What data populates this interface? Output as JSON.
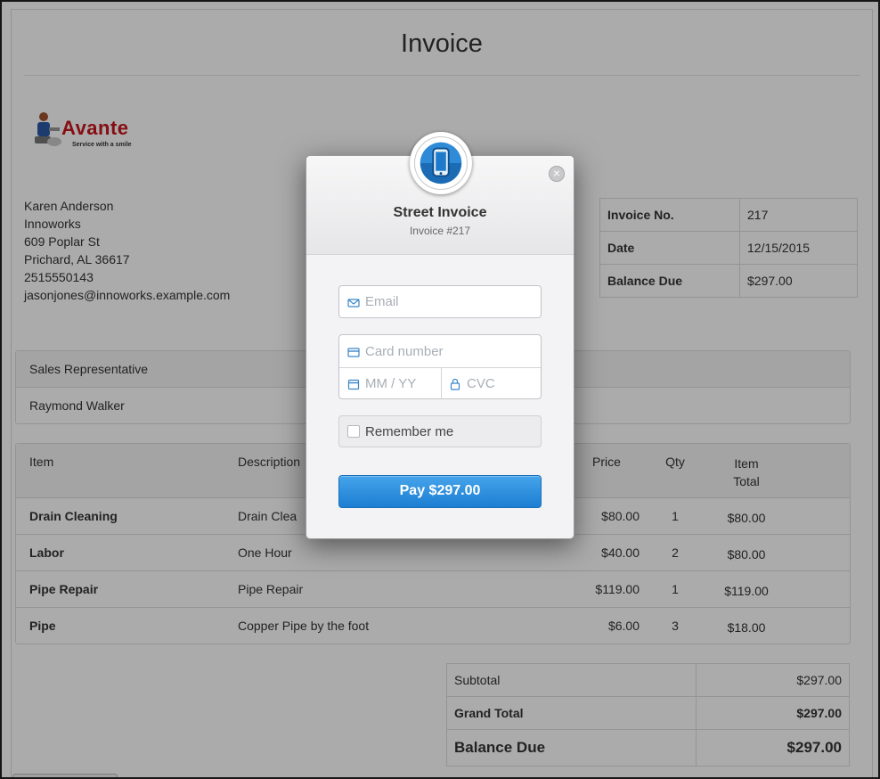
{
  "invoice": {
    "title": "Invoice",
    "logo": {
      "brand": "Avante",
      "tagline": "Service with a smile"
    },
    "customer": [
      "Karen Anderson",
      "Innoworks",
      "609 Poplar St",
      "Prichard, AL 36617",
      "2515550143",
      "jasonjones@innoworks.example.com"
    ],
    "meta": [
      {
        "label": "Invoice No.",
        "value": "217"
      },
      {
        "label": "Date",
        "value": "12/15/2015"
      },
      {
        "label": "Balance Due",
        "value": "$297.00"
      }
    ],
    "sales": {
      "header": "Sales Representative",
      "name": "Raymond Walker"
    },
    "items_header": {
      "item": "Item",
      "description": "Description",
      "price": "Price",
      "qty": "Qty",
      "total_line1": "Item",
      "total_line2": "Total"
    },
    "items": [
      {
        "item": "Drain Cleaning",
        "description": "Drain Clea",
        "price": "$80.00",
        "qty": "1",
        "total": "$80.00"
      },
      {
        "item": "Labor",
        "description": "One Hour",
        "price": "$40.00",
        "qty": "2",
        "total": "$80.00"
      },
      {
        "item": "Pipe Repair",
        "description": "Pipe Repair",
        "price": "$119.00",
        "qty": "1",
        "total": "$119.00"
      },
      {
        "item": "Pipe",
        "description": "Copper Pipe by the foot",
        "price": "$6.00",
        "qty": "3",
        "total": "$18.00"
      }
    ],
    "totals": [
      {
        "label": "Subtotal",
        "value": "$297.00"
      },
      {
        "label": "Grand Total",
        "value": "$297.00"
      },
      {
        "label": "Balance Due",
        "value": "$297.00"
      }
    ]
  },
  "checkout": {
    "title": "Street Invoice",
    "subtitle": "Invoice #217",
    "email_placeholder": "Email",
    "card_placeholder": "Card number",
    "expiry_placeholder": "MM / YY",
    "cvc_placeholder": "CVC",
    "remember_label": "Remember me",
    "pay_label": "Pay $297.00"
  },
  "colors": {
    "accent": "#2a8ee0",
    "brand": "#c8161d"
  }
}
